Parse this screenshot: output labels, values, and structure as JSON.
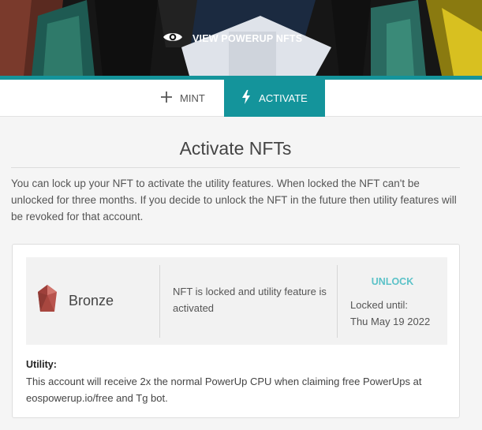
{
  "header": {
    "view_button_label": "VIEW POWERUP NFTS",
    "view_icon": "eye-icon"
  },
  "tabs": [
    {
      "label": "MINT",
      "icon": "plus-icon",
      "active": false
    },
    {
      "label": "ACTIVATE",
      "icon": "lightning-icon",
      "active": true
    }
  ],
  "main": {
    "title": "Activate NFTs",
    "description": "You can lock up your NFT to activate the utility features. When locked the NFT can't be unlocked for three months. If you decide to unlock the NFT in the future then utility features will be revoked for that account."
  },
  "nft": {
    "name": "Bronze",
    "gem_icon": "bronze-gem-icon",
    "status": "NFT is locked and utility feature is activated",
    "unlock_label": "UNLOCK",
    "locked_until_label": "Locked until:",
    "locked_until_date": "Thu May 19 2022",
    "utility_label": "Utility:",
    "utility_text": "This account will receive 2x the normal PowerUp CPU when claiming free PowerUps at eospowerup.io/free and Tg bot."
  },
  "colors": {
    "accent": "#14949b",
    "unlock": "#5bc2c8",
    "gem": "#b8544e"
  }
}
